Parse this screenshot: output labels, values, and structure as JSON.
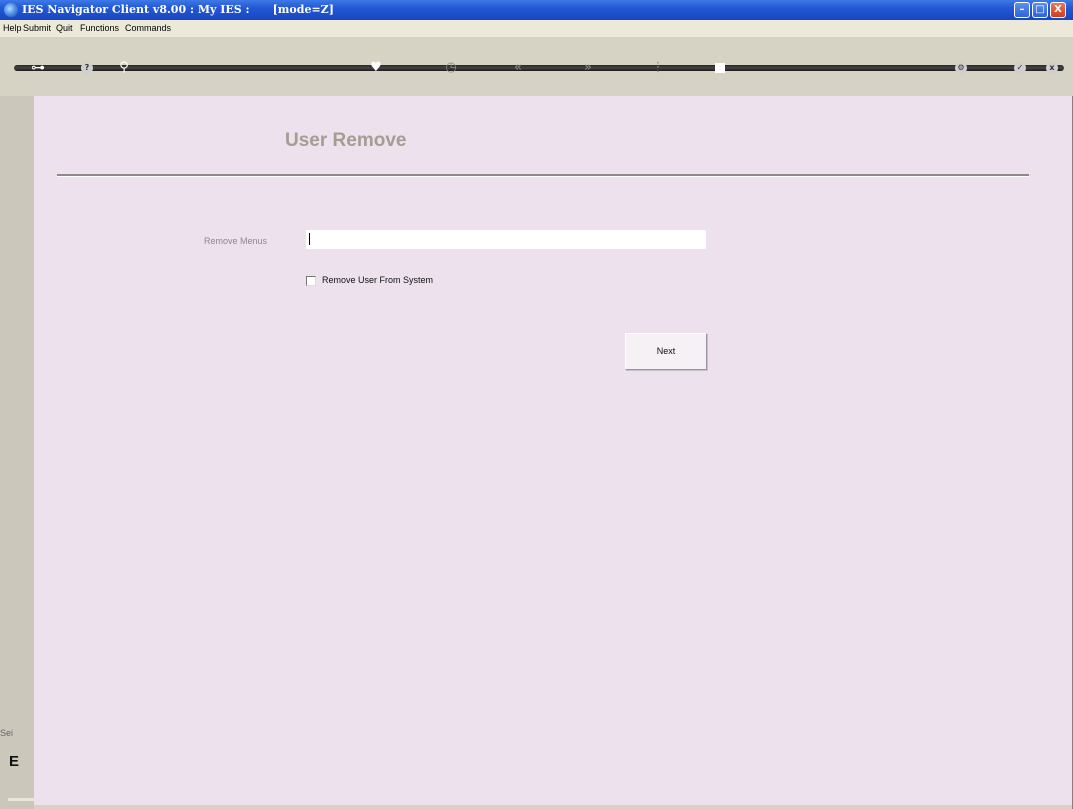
{
  "window": {
    "title": "IES Navigator Client v8.00 : My IES :      [mode=Z]",
    "min_label": "–",
    "max_label": "□",
    "close_label": "X"
  },
  "menu": {
    "items": [
      "Help",
      "Submit",
      "Quit",
      "Functions",
      "Commands"
    ]
  },
  "toolbar": {
    "icons": [
      "key-icon",
      "help-icon",
      "search-icon",
      "heart-icon",
      "clock-icon",
      "rewind-icon",
      "forward-icon",
      "filter-icon",
      "stop-icon",
      "settings-icon",
      "ok-icon",
      "cancel-icon"
    ]
  },
  "side": {
    "text": "Sei",
    "glyph": "E"
  },
  "form": {
    "title": "User Remove",
    "remove_menus_label": "Remove Menus",
    "remove_menus_value": "",
    "remove_user_label": "Remove User From System",
    "remove_user_checked": false,
    "next_label": "Next"
  }
}
